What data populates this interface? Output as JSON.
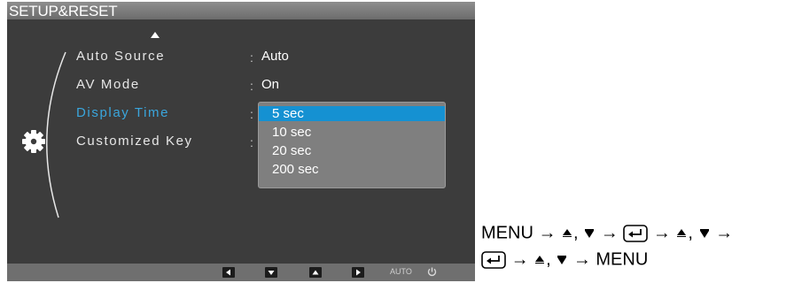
{
  "osd": {
    "title": "SETUP&RESET",
    "menu_items": [
      {
        "label": "Auto Source",
        "value": "Auto"
      },
      {
        "label": "AV Mode",
        "value": "On"
      },
      {
        "label": "Display Time",
        "value": ""
      },
      {
        "label": "Customized Key",
        "value": ""
      }
    ],
    "separator": ":",
    "dropdown": {
      "options": [
        "5 sec",
        "10 sec",
        "20 sec",
        "200 sec"
      ],
      "selected": "5 sec"
    },
    "footer": {
      "buttons": [
        "left-icon",
        "down-icon",
        "up-icon",
        "right-icon"
      ],
      "auto_label": "AUTO",
      "power_icon": "power-icon"
    },
    "colors": {
      "panel": "#3c3c3c",
      "active_label": "#3aa6dd",
      "selected_option": "#1591d2",
      "dropdown_bg": "#7f7f7f"
    }
  },
  "instructions": {
    "menu_1": "MENU",
    "menu_2": "MENU",
    "arrow": "→",
    "comma": ","
  }
}
